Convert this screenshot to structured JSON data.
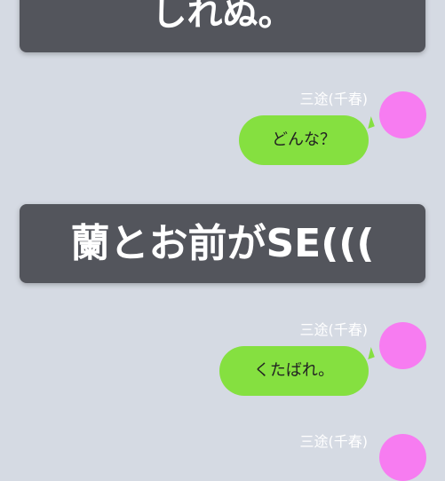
{
  "colors": {
    "background": "#d5dae3",
    "banner": "#53555c",
    "bubble": "#85e040",
    "avatar": "#f77cf1"
  },
  "messages": [
    {
      "type": "banner",
      "text": "しれぬ。"
    },
    {
      "type": "chat",
      "sender": "三途(千春)",
      "text": "どんな？",
      "avatar": "avatar-circle"
    },
    {
      "type": "banner",
      "text": "蘭とお前がSE((("
    },
    {
      "type": "chat",
      "sender": "三途(千春)",
      "text": "くたばれ。",
      "avatar": "avatar-circle"
    },
    {
      "type": "chat",
      "sender": "三途(千春)",
      "avatar": "avatar-circle"
    }
  ]
}
